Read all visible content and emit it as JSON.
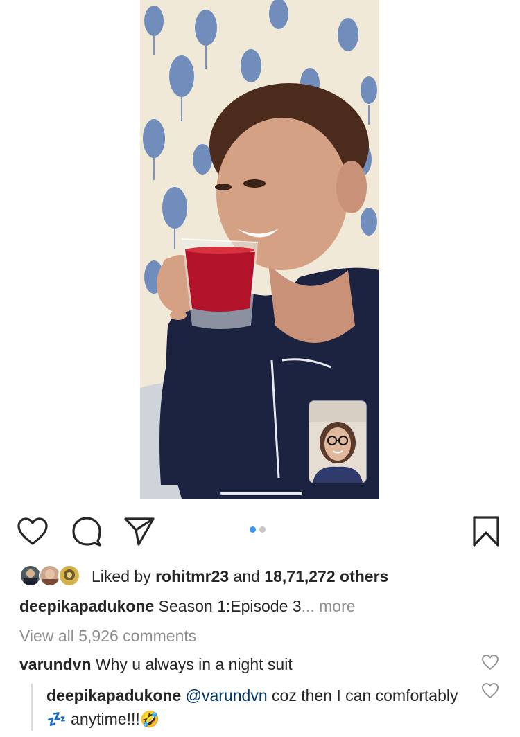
{
  "post": {
    "carousel": {
      "total": 2,
      "active_index": 0
    }
  },
  "actions": {
    "like_icon": "heart-outline-icon",
    "comment_icon": "comment-icon",
    "share_icon": "paper-plane-icon",
    "save_icon": "bookmark-icon"
  },
  "likes": {
    "prefix": "Liked by",
    "user": "rohitmr23",
    "and": "and",
    "others": "18,71,272 others"
  },
  "caption": {
    "username": "deepikapadukone",
    "text": "Season 1:Episode 3",
    "ellipsis": "...",
    "more": "more"
  },
  "comments_link": "View all 5,926 comments",
  "comments": [
    {
      "username": "varundvn",
      "text": "Why u always in a night suit"
    }
  ],
  "reply": {
    "username": "deepikapadukone",
    "mention": "@varundvn",
    "text_before_emoji": "coz then I can comfortably",
    "emoji_sleep": "💤",
    "text_after_emoji": "anytime!!!",
    "emoji_laugh": "🤣"
  },
  "colors": {
    "accent_blue": "#3897f0",
    "text": "#262626",
    "muted": "#8e8e8e",
    "mention": "#003569"
  }
}
